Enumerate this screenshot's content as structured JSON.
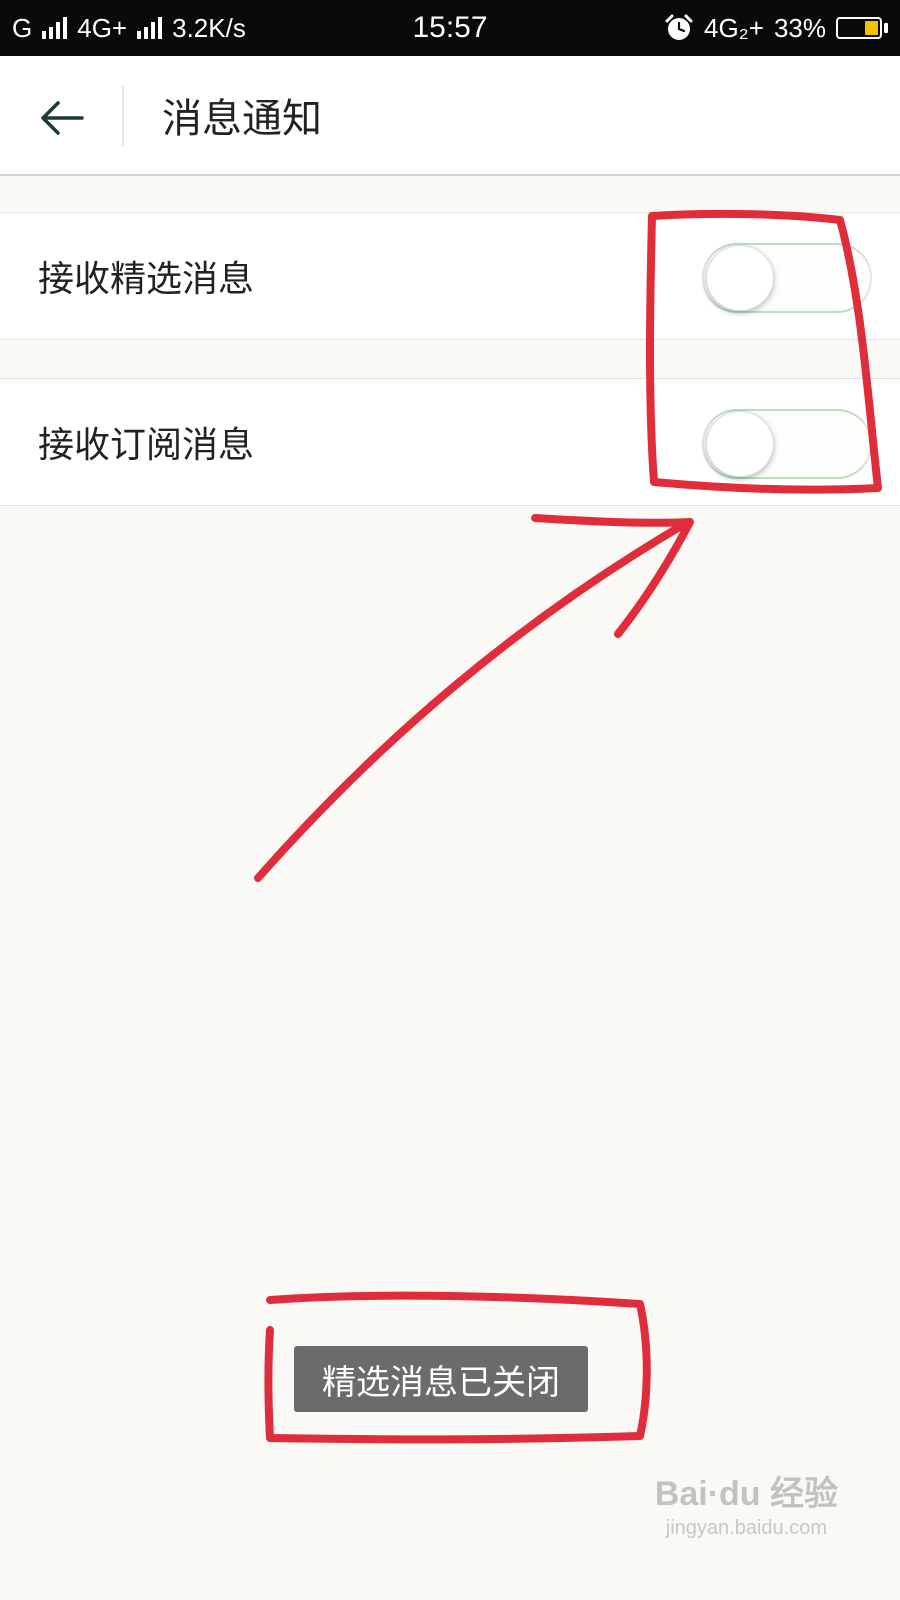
{
  "status_bar": {
    "sim1": "G",
    "sim2": "4G+",
    "speed": "3.2K/s",
    "time": "15:57",
    "net2": "4G₂+",
    "battery": "33%",
    "battery_level": 0.33,
    "battery_color": "#f2c100",
    "alarm_icon": "alarm-clock-icon"
  },
  "header": {
    "back_icon": "back-arrow-icon",
    "title": "消息通知"
  },
  "settings": [
    {
      "label": "接收精选消息",
      "enabled": false
    },
    {
      "label": "接收订阅消息",
      "enabled": false
    }
  ],
  "toast": {
    "text": "精选消息已关闭"
  },
  "annotation": {
    "color": "#e02d3c"
  },
  "watermark": {
    "brand": "Bai·du 经验",
    "url": "jingyan.baidu.com"
  }
}
